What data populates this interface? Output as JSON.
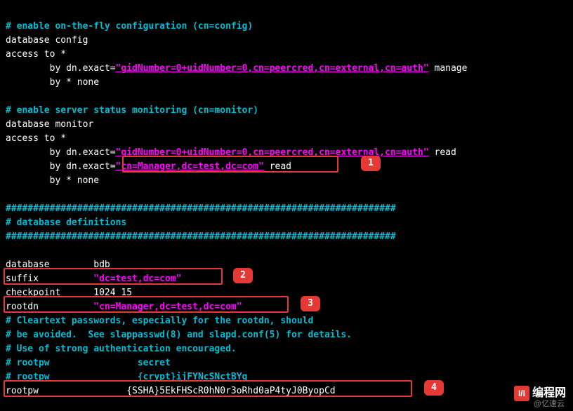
{
  "lines": {
    "c1": "# enable on-the-fly configuration (cn=config)",
    "l1": "database config",
    "l2": "access to *",
    "l3a": "        by dn.exact",
    "l3eq": "=",
    "l3str": "\"gidNumber=0+uidNumber=0,cn=peercred,cn=external,cn=auth\"",
    "l3b": " manage",
    "l4": "        by * none",
    "c2": "# enable server status monitoring (cn=monitor)",
    "l5": "database monitor",
    "l6": "access to *",
    "l7a": "        by dn.exact",
    "l7eq": "=",
    "l7str": "\"gidNumber=0+uidNumber=0,cn=peercred,cn=external,cn=auth\"",
    "l7b": " read",
    "l8a": "        by dn.exact",
    "l8eq": "=",
    "l8str": "\"cn=Manager,dc=test,dc=com\"",
    "l8b": " read",
    "l9": "        by * none",
    "h1": "#######################################################################",
    "c3": "# database definitions",
    "h2": "#######################################################################",
    "db_key": "database",
    "db_val": "        bdb",
    "suf_key": "suffix",
    "suf_val": "\"dc=test,dc=com\"",
    "chk_key": "checkpoint",
    "chk_val": "      1024 15",
    "root_key": "rootdn",
    "root_val": "\"cn=Manager,dc=test,dc=com\"",
    "cc1": "# Cleartext passwords, especially for the rootdn, should",
    "cc2": "# be avoided.  See slappasswd(8) and slapd.conf(5) for details.",
    "cc3": "# Use of strong authentication encouraged.",
    "cc4a": "# rootpw",
    "cc4b": "                secret",
    "cc5a": "# rootpw",
    "cc5b": "                {crypt}ijFYNcSNctBYg",
    "pw_key": "rootpw",
    "pw_val": "                {SSHA}5EkFHScR0hN0r3oRhd0aP4tyJ0ByopCd"
  },
  "badges": {
    "b1": "1",
    "b2": "2",
    "b3": "3",
    "b4": "4"
  },
  "watermark": {
    "main": "编程网",
    "sub": "@亿速云"
  }
}
